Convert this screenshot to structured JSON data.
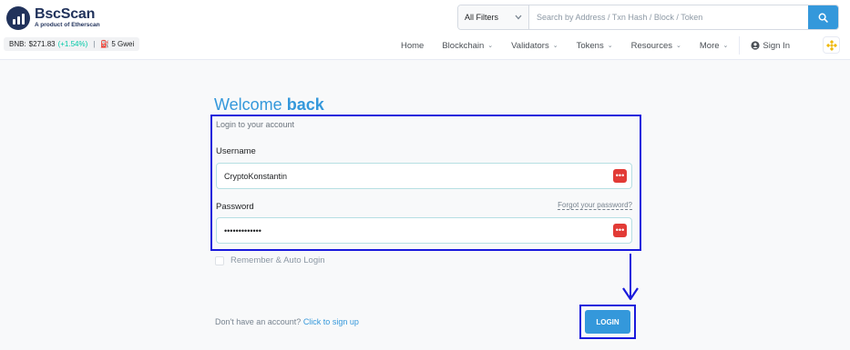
{
  "brand": {
    "name": "BscScan",
    "subtitle": "A product of Etherscan"
  },
  "price_bar": {
    "label": "BNB:",
    "price": "$271.83",
    "change": "(+1.54%)",
    "separator": "|",
    "gas": "5 Gwei"
  },
  "search": {
    "filter_label": "All Filters",
    "placeholder": "Search by Address / Txn Hash / Block / Token"
  },
  "nav": {
    "items": [
      {
        "label": "Home"
      },
      {
        "label": "Blockchain"
      },
      {
        "label": "Validators"
      },
      {
        "label": "Tokens"
      },
      {
        "label": "Resources"
      },
      {
        "label": "More"
      }
    ],
    "signin_label": "Sign In"
  },
  "login": {
    "welcome": "Welcome",
    "welcome_emphasis": "back",
    "subtitle": "Login to your account",
    "username_label": "Username",
    "username_value": "CryptoKonstantin",
    "password_label": "Password",
    "password_value": "•••••••••••••",
    "forgot_label": "Forgot your password?",
    "remember_label": "Remember & Auto Login",
    "signup_prompt": "Don't have an account?",
    "signup_link": "Click to sign up",
    "login_button": "LOGIN"
  },
  "colors": {
    "accent": "#3498db",
    "highlight": "#1a1adc",
    "password_icon": "#e23b36",
    "positive": "#00c9a7"
  }
}
